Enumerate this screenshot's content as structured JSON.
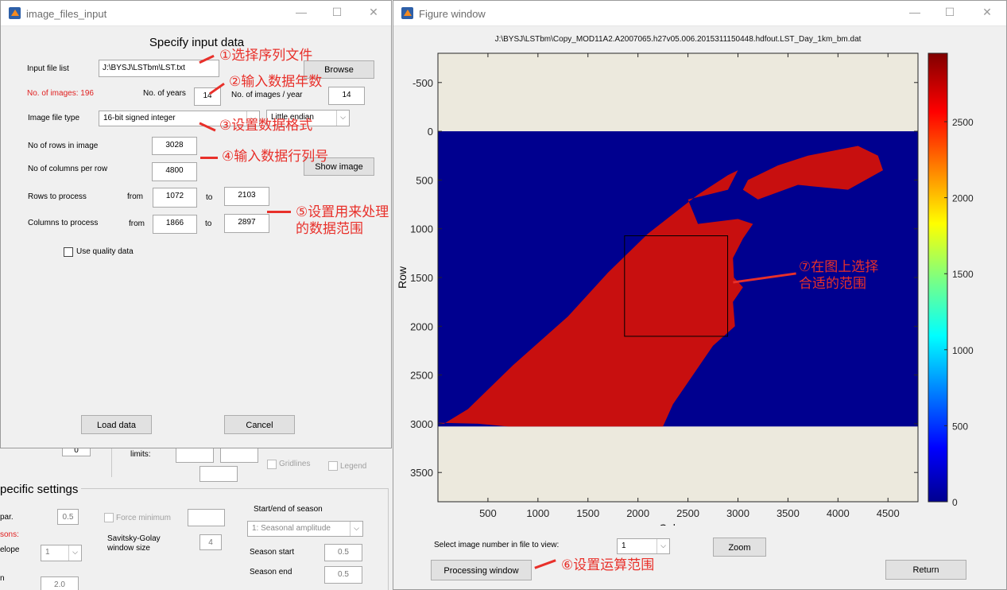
{
  "left_dialog": {
    "title": "image_files_input",
    "heading": "Specify input data",
    "input_file_list_label": "Input file list",
    "input_file_value": "J:\\BYSJ\\LSTbm\\LST.txt",
    "browse_label": "Browse",
    "num_images_text": "No. of images: 196",
    "num_years_label": "No. of years",
    "num_years_value": "14",
    "images_per_year_label": "No. of images / year",
    "images_per_year_value": "14",
    "file_type_label": "Image file type",
    "file_type_value": "16-bit signed integer",
    "endian_value": "Little endian",
    "rows_label": "No of rows in image",
    "rows_value": "3028",
    "cols_label": "No of columns per row",
    "cols_value": "4800",
    "show_image_label": "Show image",
    "rows_process_label": "Rows to process",
    "from_label": "from",
    "to_label": "to",
    "rows_from": "1072",
    "rows_to": "2103",
    "cols_process_label": "Columns to process",
    "cols_from": "1866",
    "cols_to": "2897",
    "use_quality_label": "Use quality data",
    "load_label": "Load data",
    "cancel_label": "Cancel"
  },
  "background_panel": {
    "limits_label": "limits:",
    "gridlines_label": "Gridlines",
    "legend_label": "Legend",
    "specific_settings": "pecific settings",
    "par_label": "par.",
    "par_value": "0.5",
    "sons_label": "sons:",
    "elope_label": "elope",
    "elope_value": "1",
    "n_label": "n",
    "n_value": "2.0",
    "force_min_label": "Force minimum",
    "sg_label": "Savitsky-Golay window size",
    "sg_value": "4",
    "start_end_label": "Start/end of season",
    "seasonal_value": "1: Seasonal amplitude",
    "season_start_label": "Season start",
    "season_start_value": "0.5",
    "season_end_label": "Season end",
    "season_end_value": "0.5",
    "top_small_value": "0"
  },
  "figure_window": {
    "title": "Figure window",
    "plot_title": "J:\\BYSJ\\LSTbm\\Copy_MOD11A2.A2007065.h27v05.006.2015311150448.hdfout.LST_Day_1km_bm.dat",
    "select_label": "Select image number in file to view:",
    "select_value": "1",
    "zoom_label": "Zoom",
    "processing_label": "Processing window",
    "return_label": "Return"
  },
  "chart_data": {
    "type": "heatmap",
    "title": "J:\\BYSJ\\LSTbm\\Copy_MOD11A2.A2007065.h27v05.006.2015311150448.hdfout.LST_Day_1km_bm.dat",
    "xlabel": "Column",
    "ylabel": "Row",
    "xticks": [
      500,
      1000,
      1500,
      2000,
      2500,
      3000,
      3500,
      4000,
      4500
    ],
    "yticks": [
      -500,
      0,
      500,
      1000,
      1500,
      2000,
      2500,
      3000,
      3500
    ],
    "xlim": [
      0,
      4800
    ],
    "ylim": [
      -800,
      3800
    ],
    "colorbar_ticks": [
      0,
      500,
      1000,
      1500,
      2000,
      2500
    ],
    "colormap": "jet",
    "selection_box": {
      "cols": [
        1866,
        2897
      ],
      "rows": [
        1072,
        2103
      ]
    }
  },
  "annotations": {
    "a1": "①选择序列文件",
    "a2": "②输入数据年数",
    "a3": "③设置数据格式",
    "a4": "④输入数据行列号",
    "a5_line1": "⑤设置用来处理",
    "a5_line2": "的数据范围",
    "a6": "⑥设置运算范围",
    "a7_line1": "⑦在图上选择",
    "a7_line2": "合适的范围"
  }
}
